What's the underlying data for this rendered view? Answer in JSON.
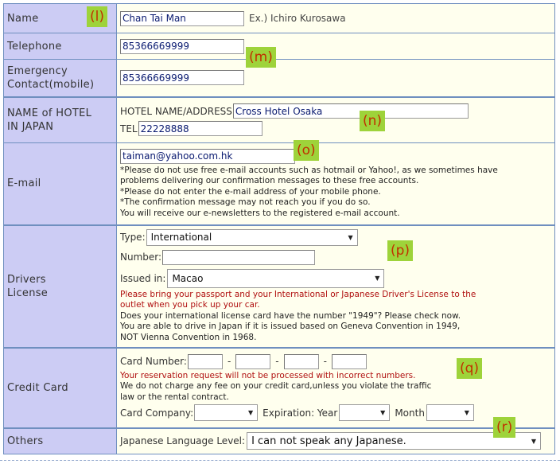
{
  "name": {
    "label": "Name",
    "value": "Chan Tai Man",
    "example": "Ex.) Ichiro Kurosawa",
    "marker": "(l)"
  },
  "telephone": {
    "label": "Telephone",
    "value": "85366669999"
  },
  "emergency": {
    "label_line1": "Emergency",
    "label_line2": "Contact(mobile)",
    "value": "85366669999",
    "marker": "(m)"
  },
  "hotel": {
    "label_line1": "NAME of HOTEL",
    "label_line2": "IN JAPAN",
    "name_label": "HOTEL NAME/ADDRESS",
    "name_value": "Cross Hotel Osaka",
    "tel_label": "TEL",
    "tel_value": "22228888",
    "marker": "(n)"
  },
  "email": {
    "label": "E-mail",
    "value": "taiman@yahoo.com.hk",
    "marker": "(o)",
    "notes": [
      "*Please do not use free e-mail accounts such as hotmail or Yahoo!, as we sometimes have",
      "problems delivering our confirmation messages to these free accounts.",
      "*Please do not enter the e-mail address of your mobile phone.",
      "*The confirmation message may not reach you if you do so.",
      "You will receive our e-newsletters to the registered e-mail account."
    ]
  },
  "license": {
    "label_line1": "Drivers",
    "label_line2": "License",
    "type_label": "Type:",
    "type_value": "International",
    "number_label": "Number:",
    "number_value": "",
    "issued_label": "Issued in:",
    "issued_value": "Macao",
    "marker": "(p)",
    "warning_lines": [
      "Please bring your passport and your International or Japanese Driver's License to the",
      "outlet when you pick up your car."
    ],
    "info_lines": [
      "Does your international license card have the number \"1949\"? Please check now.",
      "You are able to drive in Japan if it is issued based on Geneva Convention in 1949,",
      "NOT Vienna Convention in 1968."
    ]
  },
  "credit": {
    "label": "Credit Card",
    "number_label": "Card Number:",
    "dash": "-",
    "marker": "(q)",
    "warning": "Your reservation request will not be processed with incorrect numbers.",
    "info_lines": [
      "We do not charge any fee on your credit card,unless you violate the traffic",
      "law or the rental contract."
    ],
    "company_label": "Card Company:",
    "company_value": "",
    "expiration_label": "Expiration: Year",
    "year_value": "",
    "month_label": "Month",
    "month_value": ""
  },
  "others": {
    "label": "Others",
    "language_label": "Japanese Language Level:",
    "language_value": "I can not speak any Japanese.",
    "marker": "(r)"
  }
}
